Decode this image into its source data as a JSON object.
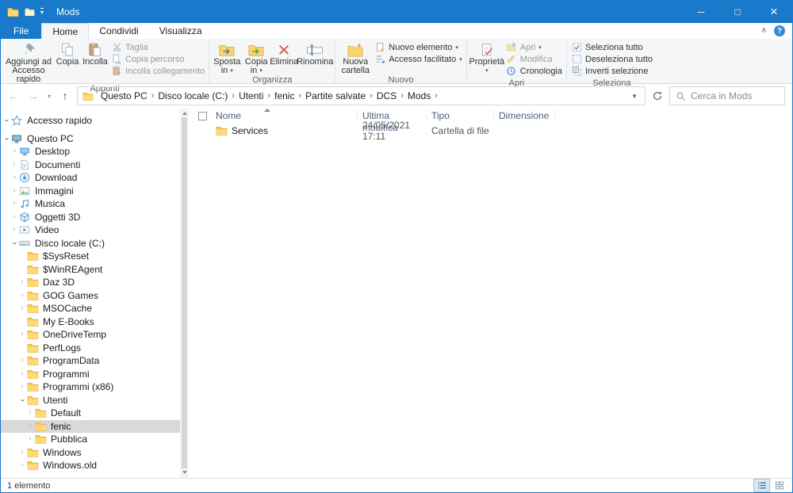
{
  "accent_color": "#1979ca",
  "window": {
    "title": "Mods"
  },
  "ribbon": {
    "tabs": [
      {
        "label": "File"
      },
      {
        "label": "Home"
      },
      {
        "label": "Condividi"
      },
      {
        "label": "Visualizza"
      }
    ],
    "groups": {
      "appunti": {
        "label": "Appunti",
        "pin": "Aggiungi ad Accesso rapido",
        "copy": "Copia",
        "paste": "Incolla",
        "cut": "Taglia",
        "copy_path": "Copia percorso",
        "paste_shortcut": "Incolla collegamento"
      },
      "organizza": {
        "label": "Organizza",
        "move_to": "Sposta in",
        "copy_to": "Copia in",
        "delete": "Elimina",
        "rename": "Rinomina"
      },
      "nuovo": {
        "label": "Nuovo",
        "new_folder": "Nuova cartella",
        "new_item": "Nuovo elemento",
        "easy_access": "Accesso facilitato"
      },
      "apri": {
        "label": "Apri",
        "properties": "Proprietà",
        "open": "Apri",
        "edit": "Modifica",
        "history": "Cronologia"
      },
      "seleziona": {
        "label": "Seleziona",
        "select_all": "Seleziona tutto",
        "deselect_all": "Deseleziona tutto",
        "invert": "Inverti selezione"
      }
    }
  },
  "address_bar": {
    "path": [
      "Questo PC",
      "Disco locale (C:)",
      "Utenti",
      "fenic",
      "Partite salvate",
      "DCS",
      "Mods"
    ],
    "search_placeholder": "Cerca in Mods"
  },
  "sidebar": {
    "items": [
      {
        "label": "Accesso rapido",
        "level": 0,
        "icon": "star-icon",
        "expand": "expanded",
        "group_gap": true
      },
      {
        "label": "Questo PC",
        "level": 0,
        "icon": "computer-icon",
        "expand": "expanded"
      },
      {
        "label": "Desktop",
        "level": 1,
        "icon": "desktop-icon",
        "expand": "collapsed"
      },
      {
        "label": "Documenti",
        "level": 1,
        "icon": "documents-icon",
        "expand": "collapsed"
      },
      {
        "label": "Download",
        "level": 1,
        "icon": "download-icon",
        "expand": "collapsed"
      },
      {
        "label": "Immagini",
        "level": 1,
        "icon": "pictures-icon",
        "expand": "collapsed"
      },
      {
        "label": "Musica",
        "level": 1,
        "icon": "music-icon",
        "expand": "collapsed"
      },
      {
        "label": "Oggetti 3D",
        "level": 1,
        "icon": "objects3d-icon",
        "expand": "collapsed"
      },
      {
        "label": "Video",
        "level": 1,
        "icon": "video-icon",
        "expand": "collapsed"
      },
      {
        "label": "Disco locale (C:)",
        "level": 1,
        "icon": "disk-icon",
        "expand": "expanded"
      },
      {
        "label": "$SysReset",
        "level": 2,
        "icon": "folder-icon",
        "expand": "none"
      },
      {
        "label": "$WinREAgent",
        "level": 2,
        "icon": "folder-icon",
        "expand": "none"
      },
      {
        "label": "Daz 3D",
        "level": 2,
        "icon": "folder-icon",
        "expand": "collapsed"
      },
      {
        "label": "GOG Games",
        "level": 2,
        "icon": "folder-icon",
        "expand": "collapsed"
      },
      {
        "label": "MSOCache",
        "level": 2,
        "icon": "folder-icon",
        "expand": "collapsed"
      },
      {
        "label": "My E-Books",
        "level": 2,
        "icon": "folder-icon",
        "expand": "none"
      },
      {
        "label": "OneDriveTemp",
        "level": 2,
        "icon": "folder-icon",
        "expand": "collapsed"
      },
      {
        "label": "PerfLogs",
        "level": 2,
        "icon": "folder-icon",
        "expand": "none"
      },
      {
        "label": "ProgramData",
        "level": 2,
        "icon": "folder-icon",
        "expand": "collapsed"
      },
      {
        "label": "Programmi",
        "level": 2,
        "icon": "folder-icon",
        "expand": "collapsed"
      },
      {
        "label": "Programmi (x86)",
        "level": 2,
        "icon": "folder-icon",
        "expand": "collapsed"
      },
      {
        "label": "Utenti",
        "level": 2,
        "icon": "folder-icon",
        "expand": "expanded"
      },
      {
        "label": "Default",
        "level": 3,
        "icon": "folder-icon",
        "expand": "collapsed"
      },
      {
        "label": "fenic",
        "level": 3,
        "icon": "folder-icon",
        "expand": "collapsed",
        "selected": true
      },
      {
        "label": "Pubblica",
        "level": 3,
        "icon": "folder-icon",
        "expand": "collapsed"
      },
      {
        "label": "Windows",
        "level": 2,
        "icon": "folder-icon",
        "expand": "collapsed"
      },
      {
        "label": "Windows.old",
        "level": 2,
        "icon": "folder-icon",
        "expand": "collapsed"
      }
    ]
  },
  "file_list": {
    "columns": [
      "Nome",
      "Ultima modifica",
      "Tipo",
      "Dimensione"
    ],
    "sort_column": "Nome",
    "rows": [
      {
        "name": "Services",
        "modified": "24/05/2021 17:11",
        "type": "Cartella di file",
        "size": ""
      }
    ]
  },
  "status_bar": {
    "text": "1 elemento"
  }
}
